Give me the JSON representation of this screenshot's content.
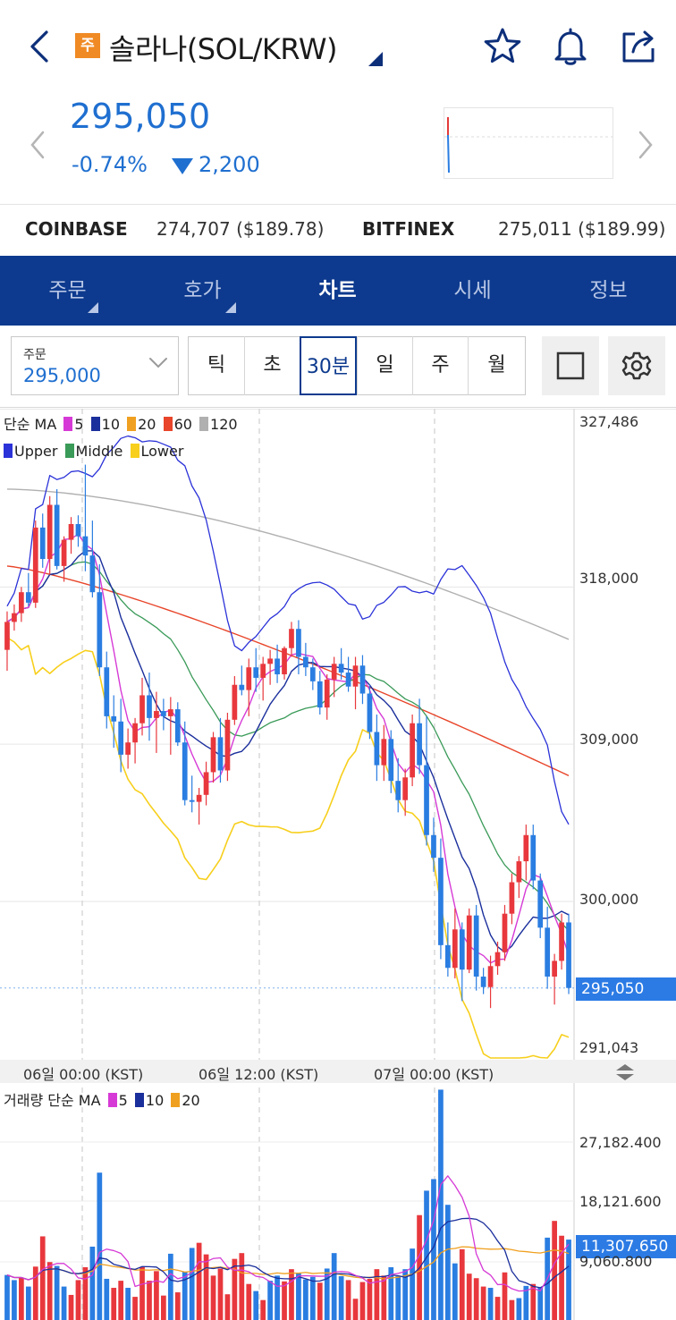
{
  "header": {
    "badge": "주",
    "title": "솔라나(SOL/KRW)",
    "icons": [
      "back-chevron-icon",
      "star-icon",
      "bell-icon",
      "share-icon"
    ]
  },
  "price": {
    "current": "295,050",
    "change_pct": "-0.74%",
    "change_abs": "2,200",
    "color": "#1f6fd0"
  },
  "exchanges": [
    {
      "name": "COINBASE",
      "value": "274,707 ($189.78)"
    },
    {
      "name": "BITFINEX",
      "value": "275,011 ($189.99)"
    }
  ],
  "tabs": [
    {
      "label": "주문",
      "active": false,
      "has_caret": true
    },
    {
      "label": "호가",
      "active": false,
      "has_caret": true
    },
    {
      "label": "차트",
      "active": true,
      "has_caret": false
    },
    {
      "label": "시세",
      "active": false,
      "has_caret": false
    },
    {
      "label": "정보",
      "active": false,
      "has_caret": false
    }
  ],
  "toolbar": {
    "order_label": "주문",
    "order_value": "295,000",
    "timeframes": [
      "틱",
      "초",
      "30분",
      "일",
      "주",
      "월"
    ],
    "active_timeframe": "30분"
  },
  "legend": {
    "ma_title": "단순 MA",
    "ma": [
      {
        "label": "5",
        "color": "#d63ad6"
      },
      {
        "label": "10",
        "color": "#1b2f9c"
      },
      {
        "label": "20",
        "color": "#f0a020"
      },
      {
        "label": "60",
        "color": "#e8452a"
      },
      {
        "label": "120",
        "color": "#b0b0b0"
      }
    ],
    "bb": [
      {
        "label": "Upper",
        "color": "#2b32d8"
      },
      {
        "label": "Middle",
        "color": "#3a9a58"
      },
      {
        "label": "Lower",
        "color": "#f7cf1c"
      }
    ],
    "vol_title": "거래량 단순 MA",
    "vol_ma": [
      {
        "label": "5",
        "color": "#d63ad6"
      },
      {
        "label": "10",
        "color": "#1b2f9c"
      },
      {
        "label": "20",
        "color": "#f0a020"
      }
    ]
  },
  "axis": {
    "price_labels": [
      "327,486",
      "318,000",
      "309,000",
      "300,000",
      "291,043"
    ],
    "current_price_tag": "295,050",
    "time_labels": [
      "06일 00:00 (KST)",
      "06일 12:00 (KST)",
      "07일 00:00 (KST)"
    ],
    "volume_labels": [
      "27,182.400",
      "18,121.600",
      "11,307.650",
      "9,060.800"
    ]
  },
  "chart_data": {
    "type": "candlestick",
    "ylim": [
      291043,
      327486
    ],
    "vol_ylim": [
      0,
      36000
    ],
    "candles": [
      [
        314400,
        316600,
        313200,
        316000
      ],
      [
        316000,
        317000,
        315500,
        316500
      ],
      [
        316500,
        318000,
        316000,
        317700
      ],
      [
        317700,
        318800,
        316900,
        317100
      ],
      [
        317100,
        321800,
        316800,
        321400
      ],
      [
        321400,
        322200,
        319100,
        319600
      ],
      [
        319600,
        323200,
        318700,
        322700
      ],
      [
        322700,
        323600,
        319000,
        319200
      ],
      [
        319200,
        320900,
        318300,
        320700
      ],
      [
        320700,
        322000,
        319900,
        321600
      ],
      [
        321600,
        322100,
        320300,
        320900
      ],
      [
        320900,
        325000,
        318900,
        319800
      ],
      [
        319800,
        321800,
        317400,
        317700
      ],
      [
        317700,
        319300,
        312900,
        313400
      ],
      [
        313400,
        314300,
        309900,
        310600
      ],
      [
        310600,
        311800,
        308800,
        310300
      ],
      [
        310300,
        311600,
        307400,
        308400
      ],
      [
        308400,
        309900,
        307600,
        309100
      ],
      [
        309100,
        310500,
        307900,
        310200
      ],
      [
        310200,
        312800,
        309500,
        311800
      ],
      [
        311800,
        313100,
        309200,
        310500
      ],
      [
        310500,
        312000,
        308500,
        310900
      ],
      [
        310900,
        311600,
        309800,
        310600
      ],
      [
        310600,
        311700,
        308400,
        311000
      ],
      [
        311000,
        311400,
        308900,
        309100
      ],
      [
        309100,
        310300,
        305500,
        305800
      ],
      [
        305800,
        307200,
        305100,
        305700
      ],
      [
        305700,
        306500,
        304400,
        306100
      ],
      [
        306100,
        308000,
        305500,
        307400
      ],
      [
        307400,
        309700,
        306800,
        309400
      ],
      [
        309400,
        310500,
        306800,
        307500
      ],
      [
        307500,
        310800,
        306900,
        310400
      ],
      [
        310400,
        312900,
        310100,
        312400
      ],
      [
        312400,
        313500,
        311800,
        312100
      ],
      [
        312100,
        313900,
        310600,
        313400
      ],
      [
        313400,
        314500,
        312000,
        312800
      ],
      [
        312800,
        314000,
        311500,
        313600
      ],
      [
        313600,
        314400,
        312400,
        313900
      ],
      [
        313900,
        314700,
        312500,
        313000
      ],
      [
        313000,
        314600,
        312700,
        314500
      ],
      [
        314500,
        316000,
        314000,
        315600
      ],
      [
        315600,
        316100,
        313000,
        314000
      ],
      [
        314000,
        314800,
        312900,
        313400
      ],
      [
        313400,
        313900,
        312100,
        312600
      ],
      [
        312600,
        313200,
        310700,
        311100
      ],
      [
        311100,
        313000,
        310400,
        312700
      ],
      [
        312700,
        314000,
        311700,
        313600
      ],
      [
        313600,
        314500,
        312700,
        313100
      ],
      [
        313100,
        314000,
        312000,
        312300
      ],
      [
        312300,
        314000,
        311000,
        313500
      ],
      [
        313500,
        314100,
        311300,
        311900
      ],
      [
        311900,
        312400,
        309300,
        309700
      ],
      [
        309700,
        310700,
        306900,
        307800
      ],
      [
        307800,
        310100,
        306900,
        309300
      ],
      [
        309300,
        309800,
        306200,
        306900
      ],
      [
        306900,
        308200,
        305100,
        305800
      ],
      [
        305800,
        307600,
        304900,
        307100
      ],
      [
        307100,
        310700,
        306600,
        310200
      ],
      [
        310200,
        311600,
        307300,
        307800
      ],
      [
        307800,
        310600,
        303200,
        303800
      ],
      [
        303800,
        304800,
        301700,
        302500
      ],
      [
        302500,
        303600,
        296700,
        297500
      ],
      [
        297500,
        298800,
        295700,
        296200
      ],
      [
        296200,
        299600,
        295600,
        298400
      ],
      [
        298400,
        298800,
        294300,
        296100
      ],
      [
        296100,
        299600,
        295900,
        299200
      ],
      [
        299200,
        299800,
        294900,
        295700
      ],
      [
        295700,
        296200,
        294700,
        295100
      ],
      [
        295100,
        296900,
        293900,
        296300
      ],
      [
        296300,
        297700,
        295800,
        297100
      ],
      [
        297100,
        299800,
        296600,
        299300
      ],
      [
        299300,
        301600,
        298700,
        301100
      ],
      [
        301100,
        302600,
        300200,
        302300
      ],
      [
        302300,
        304400,
        301200,
        303800
      ],
      [
        303800,
        304400,
        300700,
        301200
      ],
      [
        301200,
        301600,
        297900,
        298500
      ],
      [
        298500,
        299700,
        295000,
        295700
      ],
      [
        295700,
        297000,
        294100,
        296600
      ],
      [
        296600,
        299300,
        296100,
        298800
      ],
      [
        298800,
        299300,
        294700,
        295050
      ]
    ],
    "volumes": [
      [
        7000,
        "b"
      ],
      [
        6200,
        "b"
      ],
      [
        6600,
        "r"
      ],
      [
        5200,
        "b"
      ],
      [
        8300,
        "r"
      ],
      [
        13000,
        "r"
      ],
      [
        9000,
        "r"
      ],
      [
        8400,
        "b"
      ],
      [
        5200,
        "b"
      ],
      [
        3900,
        "r"
      ],
      [
        6200,
        "r"
      ],
      [
        8200,
        "r"
      ],
      [
        11400,
        "b"
      ],
      [
        22900,
        "b"
      ],
      [
        6400,
        "b"
      ],
      [
        5000,
        "r"
      ],
      [
        6100,
        "r"
      ],
      [
        5000,
        "b"
      ],
      [
        3600,
        "r"
      ],
      [
        8200,
        "r"
      ],
      [
        6100,
        "r"
      ],
      [
        7600,
        "r"
      ],
      [
        3800,
        "r"
      ],
      [
        10300,
        "b"
      ],
      [
        4300,
        "r"
      ],
      [
        7500,
        "b"
      ],
      [
        11200,
        "b"
      ],
      [
        12000,
        "r"
      ],
      [
        10200,
        "r"
      ],
      [
        6900,
        "r"
      ],
      [
        8000,
        "r"
      ],
      [
        4000,
        "r"
      ],
      [
        9500,
        "r"
      ],
      [
        10400,
        "r"
      ],
      [
        5600,
        "r"
      ],
      [
        4500,
        "b"
      ],
      [
        3100,
        "r"
      ],
      [
        6100,
        "b"
      ],
      [
        6900,
        "b"
      ],
      [
        6000,
        "r"
      ],
      [
        7900,
        "r"
      ],
      [
        7300,
        "b"
      ],
      [
        6300,
        "b"
      ],
      [
        6700,
        "b"
      ],
      [
        5800,
        "r"
      ],
      [
        8000,
        "b"
      ],
      [
        10400,
        "b"
      ],
      [
        6800,
        "b"
      ],
      [
        6200,
        "r"
      ],
      [
        3300,
        "r"
      ],
      [
        5900,
        "r"
      ],
      [
        6400,
        "r"
      ],
      [
        7900,
        "r"
      ],
      [
        6900,
        "r"
      ],
      [
        8200,
        "b"
      ],
      [
        6800,
        "b"
      ],
      [
        7900,
        "b"
      ],
      [
        11100,
        "b"
      ],
      [
        16300,
        "r"
      ],
      [
        20100,
        "b"
      ],
      [
        21900,
        "b"
      ],
      [
        35800,
        "b"
      ],
      [
        17900,
        "b"
      ],
      [
        8800,
        "b"
      ],
      [
        11000,
        "r"
      ],
      [
        7200,
        "r"
      ],
      [
        6500,
        "r"
      ],
      [
        5200,
        "r"
      ],
      [
        5000,
        "b"
      ],
      [
        3600,
        "r"
      ],
      [
        7400,
        "r"
      ],
      [
        3100,
        "r"
      ],
      [
        3400,
        "b"
      ],
      [
        5300,
        "b"
      ],
      [
        5600,
        "r"
      ],
      [
        5100,
        "b"
      ],
      [
        12800,
        "b"
      ],
      [
        15400,
        "r"
      ],
      [
        13100,
        "r"
      ],
      [
        12500,
        "b"
      ]
    ]
  }
}
